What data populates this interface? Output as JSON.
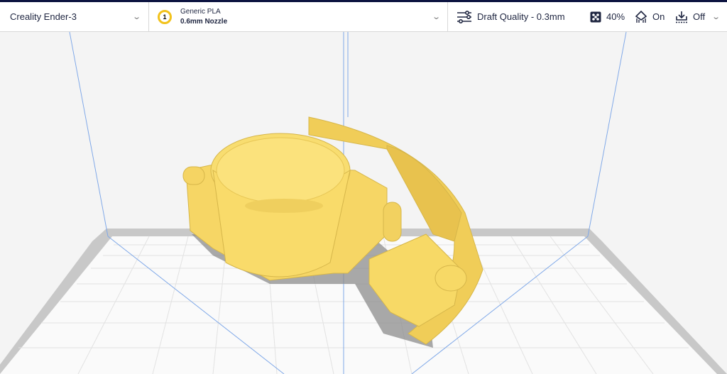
{
  "printer": {
    "name": "Creality Ender-3"
  },
  "material": {
    "extruder_number": "1",
    "name": "Generic PLA",
    "nozzle": "0.6mm Nozzle"
  },
  "print_settings": {
    "profile": "Draft Quality - 0.3mm",
    "infill": "40%",
    "support": "On",
    "adhesion": "Off"
  },
  "colors": {
    "model": "#f7d966",
    "accent": "#f2c21b",
    "header_bar": "#0c1340"
  }
}
